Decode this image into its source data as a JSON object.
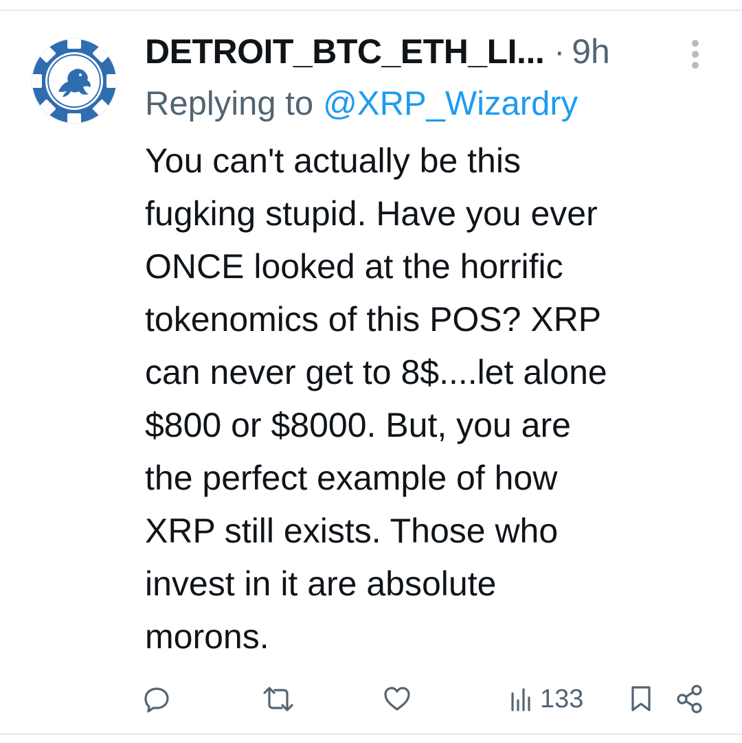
{
  "tweet": {
    "author": {
      "display_name": "DETROIT_BTC_ETH_LI...",
      "avatar_icon": "lion-poker-chip-avatar"
    },
    "separator": "·",
    "time": "9h",
    "replying": {
      "label": "Replying to",
      "mention": "@XRP_Wizardry"
    },
    "text_lines": [
      "You can't actually be this",
      "fugking stupid. Have you ever",
      "ONCE looked at the horrific",
      "tokenomics of this POS? XRP",
      "can never get to 8$....let alone",
      "$800 or $8000. But, you are",
      "the perfect example of how",
      "XRP still exists. Those who",
      "invest in it are absolute",
      "morons."
    ],
    "actions": {
      "reply_icon": "reply-icon",
      "retweet_icon": "retweet-icon",
      "like_icon": "heart-icon",
      "views_icon": "views-chart-icon",
      "views_count": "133",
      "bookmark_icon": "bookmark-icon",
      "share_icon": "share-icon"
    }
  },
  "colors": {
    "text": "#0f1419",
    "secondary": "#536471",
    "link": "#1d9bf0",
    "avatar_blue": "#2f6db1",
    "divider": "#e6e8ea"
  }
}
